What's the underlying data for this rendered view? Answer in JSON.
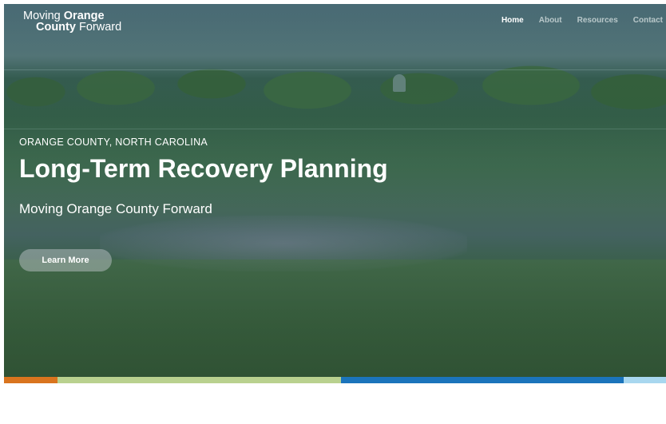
{
  "logo": {
    "line1_normal": "Moving ",
    "line1_bold": "Orange",
    "line2_bold": "County",
    "line2_normal": " Forward"
  },
  "nav": {
    "items": [
      {
        "label": "Home",
        "active": true
      },
      {
        "label": "About",
        "active": false
      },
      {
        "label": "Resources",
        "active": false
      },
      {
        "label": "Contact",
        "active": false
      }
    ]
  },
  "hero": {
    "kicker": "ORANGE COUNTY, NORTH CAROLINA",
    "headline": "Long-Term Recovery Planning",
    "subhead": "Moving Orange County Forward",
    "cta_label": "Learn More"
  },
  "color_bar": {
    "segments": [
      "#d9741e",
      "#b9d18f",
      "#1b74bb",
      "#a8d7ef"
    ]
  }
}
